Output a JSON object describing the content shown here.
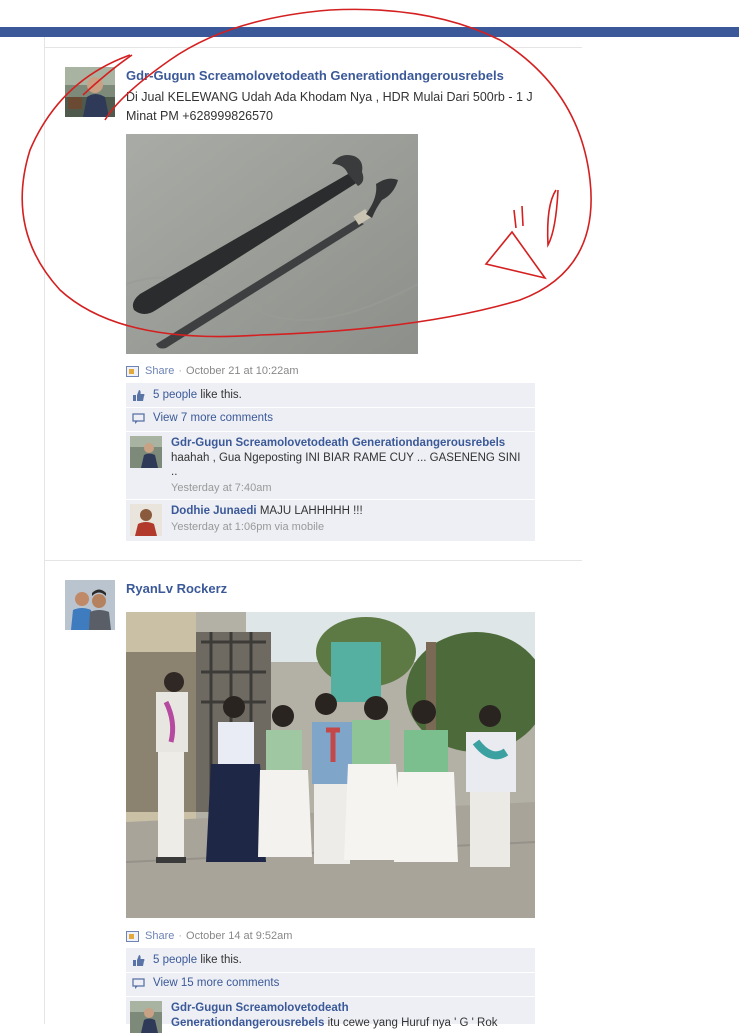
{
  "posts": [
    {
      "author": "Gdr-Gugun Screamolovetodeath Generationdangerousrebels",
      "message": "Di Jual KELEWANG Udah Ada Khodam Nya , HDR Mulai Dari 500rb - 1 J Minat PM +628999826570",
      "share_label": "Share",
      "separator": "·",
      "timestamp": "October 21 at 10:22am",
      "likes_text": "5 people",
      "likes_suffix": " like this.",
      "view_comments": "View 7 more comments",
      "comments": [
        {
          "name": "Gdr-Gugun Screamolovetodeath Generationdangerousrebels",
          "text": " haahah , Gua Ngeposting INI BIAR RAME CUY ... GASENENG SINI ..",
          "time": "Yesterday at 7:40am"
        },
        {
          "name": "Dodhie Junaedi",
          "text": " MAJU LAHHHHH !!!",
          "time": "Yesterday at 1:06pm via mobile"
        }
      ]
    },
    {
      "author": "RyanLv Rockerz",
      "share_label": "Share",
      "separator": "·",
      "timestamp": "October 14 at 9:52am",
      "likes_text": "5 people",
      "likes_suffix": " like this.",
      "view_comments": "View 15 more comments",
      "comments": [
        {
          "name": "Gdr-Gugun Screamolovetodeath",
          "name2": "Generationdangerousrebels",
          "text": " itu cewe yang Huruf nya ' G ' Rok"
        }
      ]
    }
  ],
  "colors": {
    "brand": "#3b5998",
    "ufi_bg": "#edeff4",
    "annotation": "#d42020"
  },
  "icons": [
    "like-thumb-icon",
    "comment-bubble-icon",
    "share-icon"
  ]
}
